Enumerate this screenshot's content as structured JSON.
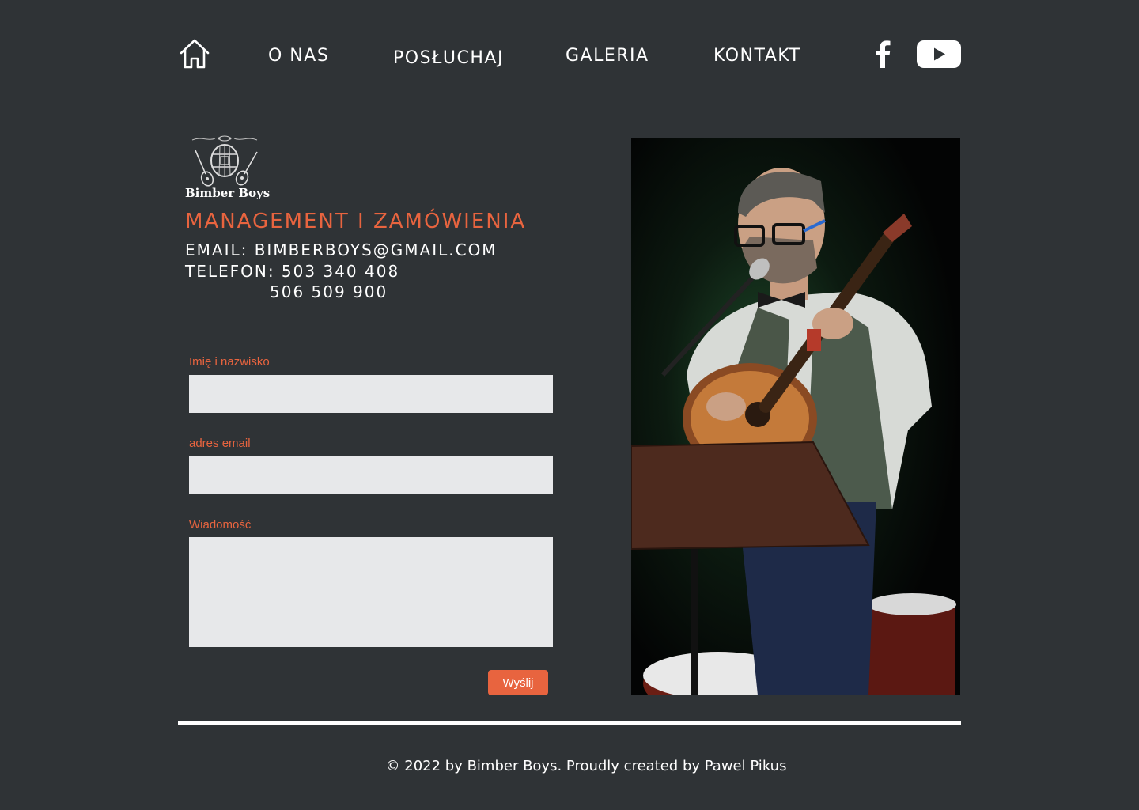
{
  "nav": {
    "home_icon": "home-icon",
    "items": [
      "O NAS",
      "POSŁUCHAJ",
      "GALERIA",
      "KONTAKT"
    ],
    "facebook_icon": "facebook-icon",
    "youtube_icon": "youtube-icon"
  },
  "logo": {
    "text": "Bimber Boys"
  },
  "contact": {
    "title": "MANAGEMENT I ZAMÓWIENIA",
    "email_line": "EMAIL: BIMBERBOYS@GMAIL.COM",
    "phone_line": "TELEFON: 503 340 408",
    "phone_line_2": "506 509 900"
  },
  "form": {
    "name_label": "Imię i nazwisko",
    "name_value": "",
    "email_label": "adres email",
    "email_value": "",
    "message_label": "Wiadomość",
    "message_value": "",
    "submit_label": "Wyślij"
  },
  "footer": {
    "text": "© 2022 by Bimber Boys. Proudly created by Pawel Pikus"
  },
  "colors": {
    "background": "#2f3336",
    "accent": "#e8643f",
    "field_bg": "#e7e8ea",
    "text": "#ffffff"
  }
}
